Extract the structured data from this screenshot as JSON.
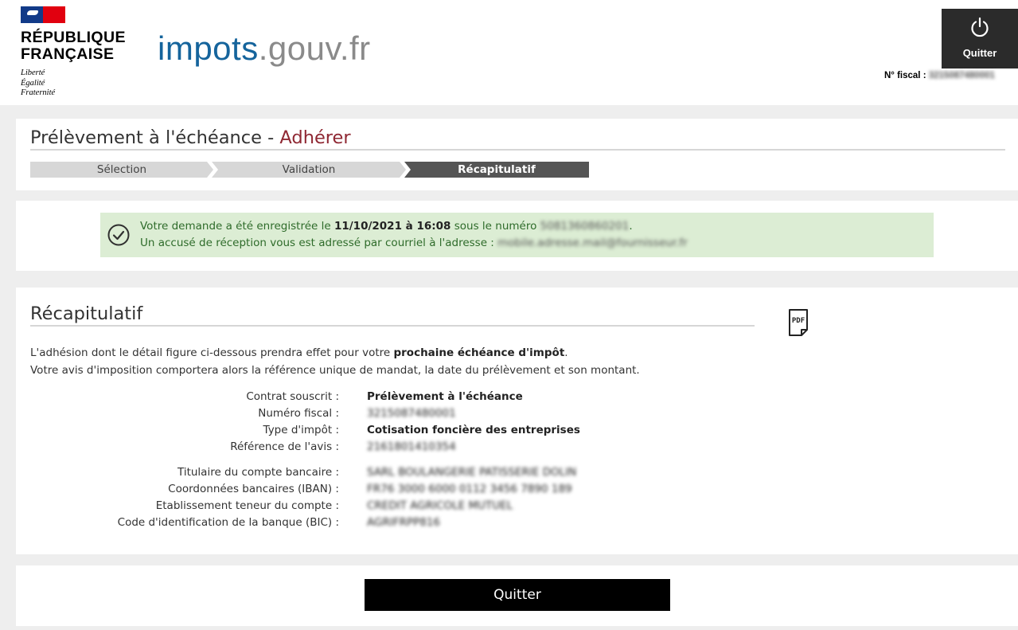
{
  "header": {
    "republique_line1": "RÉPUBLIQUE",
    "republique_line2": "FRANÇAISE",
    "motto_1": "Liberté",
    "motto_2": "Égalité",
    "motto_3": "Fraternité",
    "brand_part1": "impots",
    "brand_part2": ".gouv.fr",
    "quit_label": "Quitter",
    "fiscal_label": "N° fiscal :",
    "fiscal_value": "3215087480001"
  },
  "page": {
    "title": "Prélèvement à l'échéance",
    "title_separator": " - ",
    "title_accent": "Adhérer",
    "steps": [
      "Sélection",
      "Validation",
      "Récapitulatif"
    ],
    "active_step": "Récapitulatif"
  },
  "confirmation": {
    "line1_prefix": "Votre demande a été enregistrée le ",
    "line1_datetime": "11/10/2021 à 16:08",
    "line1_mid": " sous le numéro ",
    "line1_number": "5081360860201",
    "line1_suffix": ".",
    "line2_prefix": "Un accusé de réception vous est adressé par courriel à l'adresse : ",
    "line2_email": "mobile.adresse.mail@fournisseur.fr"
  },
  "recap": {
    "title": "Récapitulatif",
    "intro_line1_prefix": "L'adhésion dont le détail figure ci-dessous prendra effet pour votre ",
    "intro_line1_bold": "prochaine échéance d'impôt",
    "intro_line1_suffix": ".",
    "intro_line2": "Votre avis d'imposition comportera alors la référence unique de mandat, la date du prélèvement et son montant.",
    "fields": [
      {
        "label": "Contrat souscrit :",
        "value": "Prélèvement à l'échéance"
      },
      {
        "label": "Numéro fiscal :",
        "value": "3215087480001"
      },
      {
        "label": "Type d'impôt :",
        "value": "Cotisation foncière des entreprises"
      },
      {
        "label": "Référence de l'avis :",
        "value": "2161801410354"
      },
      {
        "label": "Titulaire du compte bancaire :",
        "value": "SARL BOULANGERIE PATISSERIE DOLIN"
      },
      {
        "label": "Coordonnées bancaires (IBAN) :",
        "value": "FR76 3000 6000 0112 3456 7890 189"
      },
      {
        "label": "Etablissement teneur du compte :",
        "value": "CREDIT AGRICOLE MUTUEL"
      },
      {
        "label": "Code d'identification de la banque (BIC) :",
        "value": "AGRIFRPP816"
      }
    ]
  },
  "footer": {
    "quit_button": "Quitter"
  },
  "colors": {
    "brand_blue": "#15649c",
    "accent_red": "#8f2833",
    "success_bg": "#dcedd4",
    "success_text": "#2e6b2a",
    "flag_blue": "#123a88",
    "flag_red": "#e1000f"
  }
}
